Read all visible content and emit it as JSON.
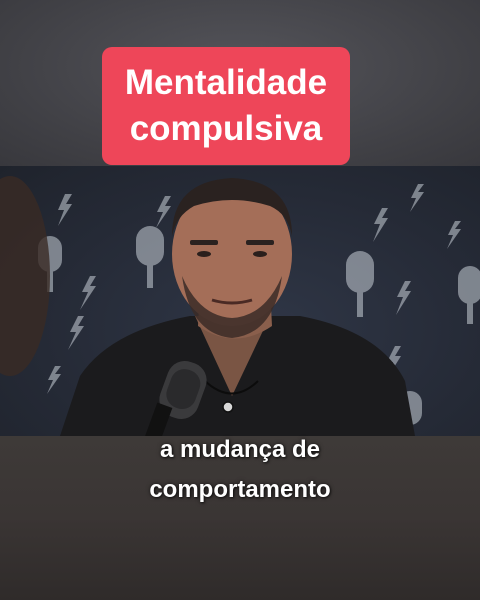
{
  "title": {
    "line1": "Mentalidade",
    "line2": "compulsiva"
  },
  "caption": {
    "line1": "a mudança de",
    "line2": "comportamento"
  },
  "colors": {
    "title_background": "#ee4659",
    "title_text": "#ffffff",
    "caption_text": "#ffffff"
  }
}
